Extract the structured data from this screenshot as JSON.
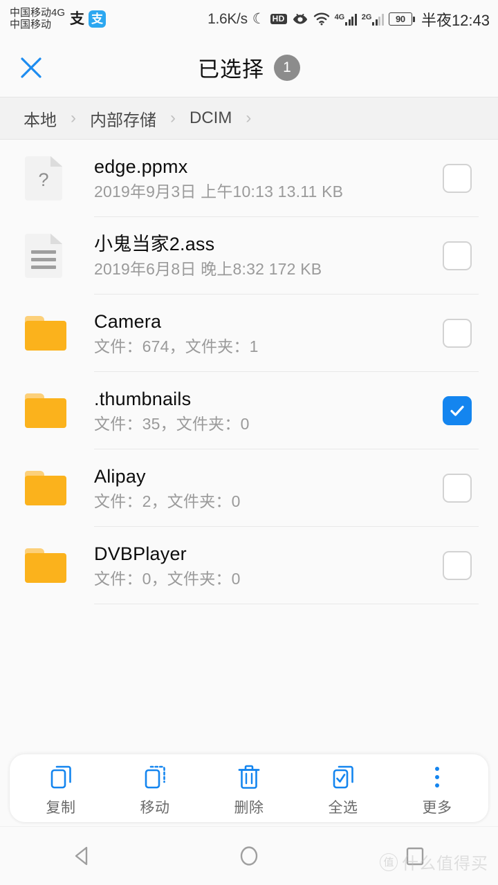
{
  "status_bar": {
    "carrier_line1": "中国移动4G",
    "carrier_line2": "中国移动",
    "alipay_glyph": "支",
    "alipay_badge": "支",
    "network_speed": "1.6K/s",
    "moon_icon": "☾",
    "hd_badge": "HD",
    "signal_1_label": "4G",
    "signal_2_label": "2G",
    "battery_level": "90",
    "clock": "半夜12:43"
  },
  "title_bar": {
    "close_label": "✕",
    "title": "已选择",
    "selected_count": "1"
  },
  "breadcrumb": {
    "items": [
      "本地",
      "内部存储",
      "DCIM"
    ],
    "separator": "›"
  },
  "file_list": [
    {
      "name": "edge.ppmx",
      "meta": "2019年9月3日 上午10:13 13.11 KB",
      "icon": "unknown-file-icon",
      "checked": false
    },
    {
      "name": "小鬼当家2.ass",
      "meta": "2019年6月8日 晚上8:32 172 KB",
      "icon": "text-file-icon",
      "checked": false
    },
    {
      "name": "Camera",
      "meta": "文件：674，文件夹：1",
      "icon": "folder-icon",
      "checked": false
    },
    {
      "name": ".thumbnails",
      "meta": "文件：35，文件夹：0",
      "icon": "folder-icon",
      "checked": true
    },
    {
      "name": "Alipay",
      "meta": "文件：2，文件夹：0",
      "icon": "folder-icon",
      "checked": false
    },
    {
      "name": "DVBPlayer",
      "meta": "文件：0，文件夹：0",
      "icon": "folder-icon",
      "checked": false
    }
  ],
  "toolbar": [
    {
      "label": "复制",
      "icon": "copy-icon"
    },
    {
      "label": "移动",
      "icon": "move-icon"
    },
    {
      "label": "删除",
      "icon": "trash-icon"
    },
    {
      "label": "全选",
      "icon": "select-all-icon"
    },
    {
      "label": "更多",
      "icon": "more-icon"
    }
  ],
  "nav_bar": {
    "back_icon": "back-triangle-icon",
    "home_icon": "home-circle-icon",
    "recents_icon": "recents-square-icon"
  },
  "watermark": {
    "mark": "值",
    "text": "什么值得买"
  },
  "colors": {
    "accent_blue": "#1485ef",
    "folder_amber": "#fbb21c",
    "page_bg": "#fafafa",
    "breadcrumb_bg": "#f2f2f2"
  }
}
